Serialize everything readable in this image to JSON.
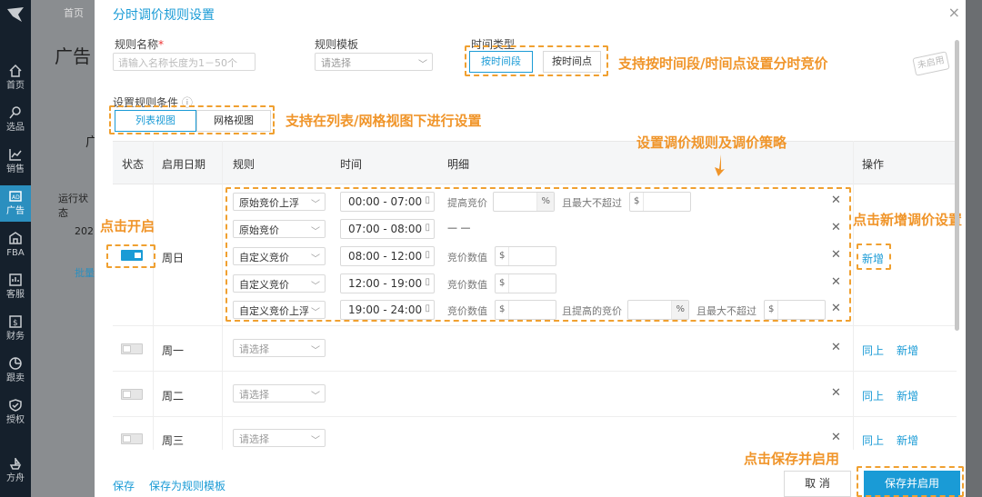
{
  "sidebar": {
    "items": [
      {
        "label": "首页",
        "icon": "home-icon"
      },
      {
        "label": "选品",
        "icon": "search-icon"
      },
      {
        "label": "销售",
        "icon": "chart-icon"
      },
      {
        "label": "广告",
        "icon": "ad-icon"
      },
      {
        "label": "FBA",
        "icon": "warehouse-icon"
      },
      {
        "label": "客服",
        "icon": "message-icon"
      },
      {
        "label": "财务",
        "icon": "finance-icon"
      },
      {
        "label": "跟卖",
        "icon": "pie-icon"
      },
      {
        "label": "授权",
        "icon": "shield-icon"
      },
      {
        "label": "方舟",
        "icon": "ark-icon"
      }
    ]
  },
  "background_page": {
    "breadcrumb": "首页",
    "title": "广告",
    "run_status": "运行状态",
    "year": "202",
    "batch": "批量",
    "partial": "广"
  },
  "modal": {
    "title": "分时调价规则设置",
    "close": "×",
    "rule_name_label": "规则名称",
    "required_mark": "*",
    "rule_name_placeholder": "请输入名称长度为1－50个",
    "template_label": "规则模板",
    "template_placeholder": "请选择",
    "time_type_label": "时间类型",
    "time_type_options": [
      "按时间段",
      "按时间点"
    ],
    "stamp": "未启用",
    "condition_label": "设置规则条件",
    "info_icon": "ⓘ",
    "view_tabs": [
      "列表视图",
      "网格视图"
    ],
    "table_headers": {
      "status": "状态",
      "date": "启用日期",
      "rule": "规则",
      "time": "时间",
      "detail": "明细",
      "action": "操作"
    },
    "sunday": {
      "day": "周日",
      "enabled": true,
      "rows": [
        {
          "rule": "原始竞价上浮",
          "time": "00:00 - 07:00",
          "detail_label": "提高竞价",
          "pct_suffix": "%",
          "max_label": "且最大不超过",
          "currency": "$"
        },
        {
          "rule": "原始竞价",
          "time": "07:00 - 08:00",
          "detail_text": "— —"
        },
        {
          "rule": "自定义竞价",
          "time": "08:00 - 12:00",
          "detail_label": "竞价数值",
          "currency": "$"
        },
        {
          "rule": "自定义竞价",
          "time": "12:00 - 19:00",
          "detail_label": "竞价数值",
          "currency": "$"
        },
        {
          "rule": "自定义竞价上浮",
          "time": "19:00 - 24:00",
          "detail_label": "竞价数值",
          "currency": "$",
          "raise_label": "且提高的竞价",
          "pct_suffix": "%",
          "max_label": "且最大不超过",
          "currency2": "$"
        }
      ],
      "add": "新增"
    },
    "other_days": [
      {
        "day": "周一",
        "placeholder": "请选择",
        "copy": "同上",
        "add": "新增"
      },
      {
        "day": "周二",
        "placeholder": "请选择",
        "copy": "同上",
        "add": "新增"
      },
      {
        "day": "周三",
        "placeholder": "请选择",
        "copy": "同上",
        "add": "新增"
      }
    ],
    "footer": {
      "save": "保存",
      "save_template": "保存为规则模板",
      "cancel": "取 消",
      "save_enable": "保存并启用"
    }
  },
  "annotations": {
    "time_type": "支持按时间段/时间点设置分时竞价",
    "view": "支持在列表/网格视图下进行设置",
    "rules": "设置调价规则及调价策略",
    "toggle": "点击开启",
    "add": "点击新增调价设置",
    "save": "点击保存并启用"
  },
  "colors": {
    "accent": "#1a9bd6",
    "annotation": "#f0952a",
    "sidebar": "#15202c"
  }
}
